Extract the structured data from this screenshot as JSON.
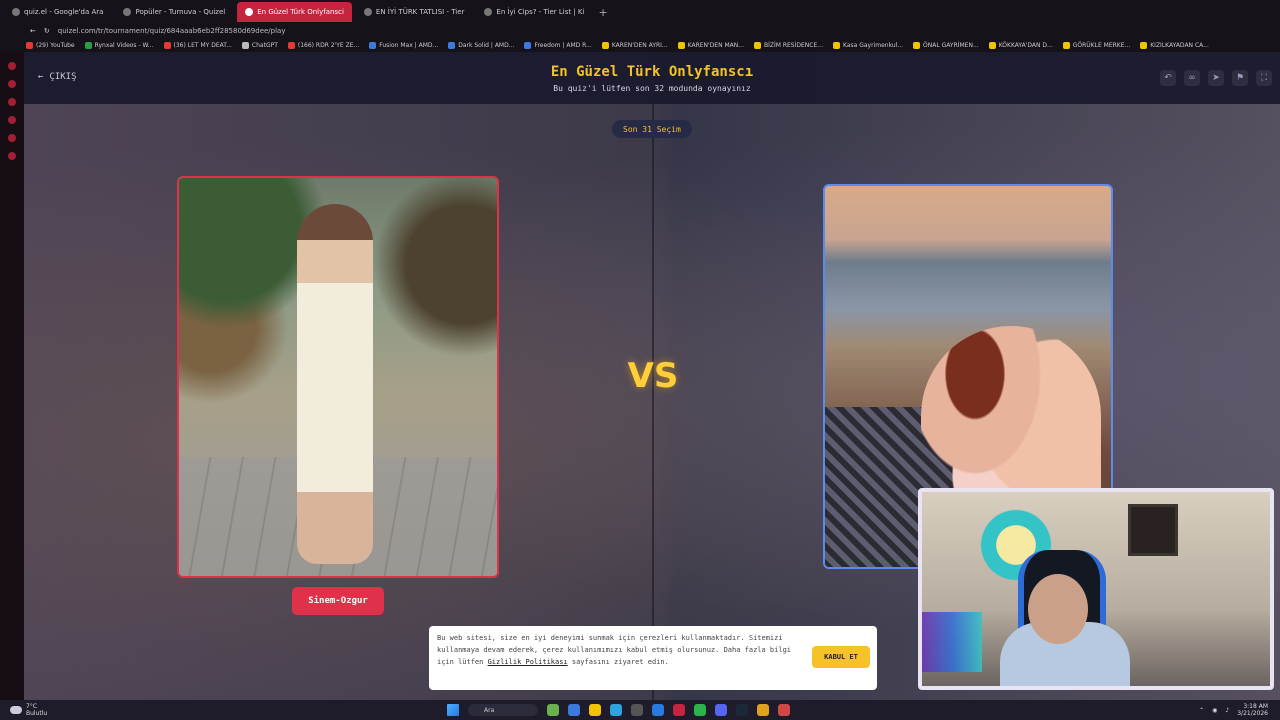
{
  "browser": {
    "tabs": [
      {
        "label": "quiz.el - Google'da Ara",
        "active": false
      },
      {
        "label": "Popüler - Turnuva - Quizel",
        "active": false
      },
      {
        "label": "En Güzel Türk Onlyfansci",
        "active": true
      },
      {
        "label": "EN İYİ TÜRK TATLISI - Tier",
        "active": false
      },
      {
        "label": "En İyi Cips? - Tier List | Ki",
        "active": false
      }
    ],
    "new_tab": "+",
    "url": "quizel.com/tr/tournament/quiz/684aaab6eb2ff28580d69dee/play",
    "bookmarks": [
      {
        "label": "(29) YouTube",
        "color": "#e53935"
      },
      {
        "label": "Rynxal Videos - W...",
        "color": "#2b9e45"
      },
      {
        "label": "(36) LET MY DEAT...",
        "color": "#e53935"
      },
      {
        "label": "ChatGPT",
        "color": "#bbbbbb"
      },
      {
        "label": "(166) RDR 2'YE ZE...",
        "color": "#e53935"
      },
      {
        "label": "Fusion Max | AMD...",
        "color": "#3b7be0"
      },
      {
        "label": "Dark Solid | AMD...",
        "color": "#3b7be0"
      },
      {
        "label": "Freedom | AMD R...",
        "color": "#3b7be0"
      },
      {
        "label": "KAREN'DEN AYRI...",
        "color": "#f2c300"
      },
      {
        "label": "KAREN'DEN MAN...",
        "color": "#f2c300"
      },
      {
        "label": "BİZİM RESİDENCE...",
        "color": "#f2c300"
      },
      {
        "label": "Kasa Gayrimenkul...",
        "color": "#f2c300"
      },
      {
        "label": "ÖNAL GAYRİMEN...",
        "color": "#f2c300"
      },
      {
        "label": "KÖKKAYA'DAN D...",
        "color": "#f2c300"
      },
      {
        "label": "GÖRÜKLE MERKE...",
        "color": "#f2c300"
      },
      {
        "label": "KIZILKAYADAN CA...",
        "color": "#f2c300"
      }
    ]
  },
  "header": {
    "exit_label": "ÇIKIŞ",
    "title": "En Güzel Türk Onlyfanscı",
    "subtitle": "Bu quiz'i lütfen son 32 modunda oynayınız",
    "tool_icons": [
      "undo-icon",
      "link-icon",
      "send-icon",
      "flag-icon",
      "fullscreen-icon"
    ]
  },
  "round": {
    "label": "Son 31 Seçim"
  },
  "matchup": {
    "left": {
      "name": "Sinem-Ozgur",
      "accent": "#e0304a"
    },
    "right": {
      "name": "",
      "accent": "#5a8cf0"
    },
    "vs_label": "VS"
  },
  "cookie": {
    "text": "Bu web sitesi, size en iyi deneyimi sunmak için çerezleri kullanmaktadır. Sitemizi kullanmaya devam ederek, çerez kullanımımızı kabul etmiş olursunuz. Daha fazla bilgi için lütfen ",
    "link": "Gizlilik Politikası",
    "suffix": " sayfasını ziyaret edin.",
    "accept": "KABUL ET"
  },
  "taskbar": {
    "weather_temp": "7°C",
    "weather_desc": "Bulutlu",
    "search_placeholder": "Ara",
    "time": "3:18 AM",
    "date": "3/21/2026"
  },
  "colors": {
    "accent_yellow": "#f5c228",
    "header_bg": "#19192d"
  }
}
